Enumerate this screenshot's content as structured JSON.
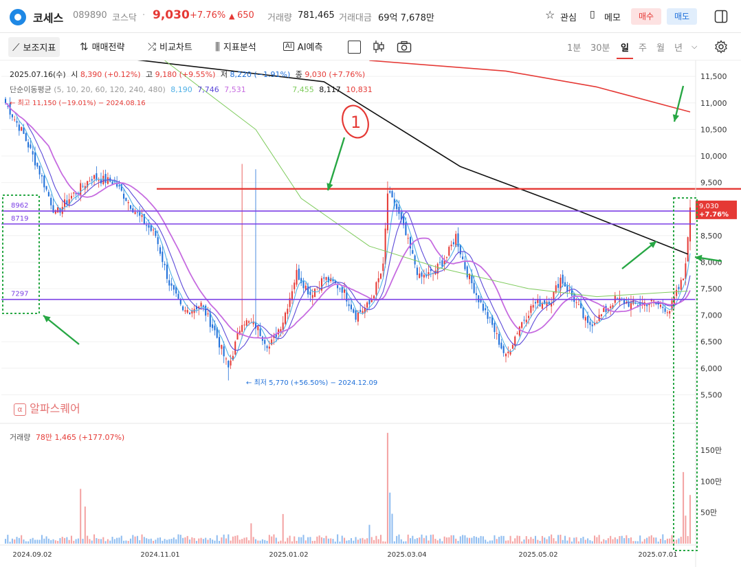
{
  "header": {
    "name": "코세스",
    "code": "089890",
    "market": "코스닥",
    "dot": "·",
    "price": "9,030",
    "change_pct": "+7.76%",
    "change_arrow": "▲",
    "change_amt": "650",
    "volume_label": "거래량",
    "volume": "781,465",
    "amount_label": "거래대금",
    "amount": "69억 7,678만",
    "fav_label": "관심",
    "memo_label": "메모",
    "buy_label": "매수",
    "sell_label": "매도"
  },
  "toolbar": {
    "indicators": "보조지표",
    "strategy": "매매전략",
    "compare": "비교차트",
    "analysis": "지표분석",
    "ai": "AI예측",
    "timeframes": [
      "1분",
      "30분",
      "일",
      "주",
      "월",
      "년"
    ],
    "active_timeframe": "일"
  },
  "ohlc": {
    "date": "2025.07.16(수)",
    "open_label": "시",
    "open": "8,390 (+0.12%)",
    "high_label": "고",
    "high": "9,180 (+9.55%)",
    "low_label": "저",
    "low": "8,220 (−1.91%)",
    "close_label": "종",
    "close": "9,030 (+7.76%)"
  },
  "ma": {
    "label": "단순이동평균",
    "periods": "(5, 10, 20, 60, 120, 240, 480)",
    "values": [
      {
        "v": "8,190",
        "color": "#4fb0e6"
      },
      {
        "v": "7,746",
        "color": "#5a48d8"
      },
      {
        "v": "7,531",
        "color": "#c66be0"
      },
      {
        "v": "7,455",
        "color": "#7ecb5c"
      },
      {
        "v": "8,117",
        "color": "#111111"
      },
      {
        "v": "10,831",
        "color": "#e53935"
      }
    ]
  },
  "annotations": {
    "high_marker": "최고 11,150 (−19.01%) − 2024.08.16",
    "low_marker": "최저 5,770 (+56.50%) − 2024.12.09",
    "handwritten": "1",
    "level_8962": "8962",
    "level_8719": "8719",
    "level_7297": "7297",
    "watermark": "알파스퀘어",
    "last_price": "9,030",
    "last_pct": "+7.76%"
  },
  "volume_panel": {
    "label": "거래량",
    "value": "78만 1,465 (+177.07%)",
    "ticks": [
      "150만",
      "100만",
      "50만"
    ]
  },
  "chart_data": {
    "type": "candlestick",
    "price_axis_ticks": [
      "11,500",
      "11,000",
      "10,500",
      "10,000",
      "9,500",
      "9,000",
      "8,500",
      "8,000",
      "7,500",
      "7,000",
      "6,500",
      "6,000",
      "5,500"
    ],
    "price_range": [
      5000,
      11800
    ],
    "date_ticks": [
      "2024.09.02",
      "2024.11.01",
      "2025.01.02",
      "2025.03.04",
      "2025.05.02",
      "2025.07.01"
    ],
    "horizontal_levels": [
      {
        "value": 9380,
        "color": "#e53935",
        "label": ""
      },
      {
        "value": 8962,
        "color": "#7b3fe4",
        "label": "8962"
      },
      {
        "value": 8719,
        "color": "#7b3fe4",
        "label": "8719"
      },
      {
        "value": 7297,
        "color": "#7b3fe4",
        "label": "7297"
      }
    ],
    "series_anchor_closes": [
      [
        0,
        11000
      ],
      [
        8,
        10400
      ],
      [
        15,
        9700
      ],
      [
        22,
        8900
      ],
      [
        28,
        9200
      ],
      [
        38,
        9600
      ],
      [
        48,
        9500
      ],
      [
        58,
        8900
      ],
      [
        66,
        8500
      ],
      [
        72,
        7600
      ],
      [
        78,
        7050
      ],
      [
        86,
        7200
      ],
      [
        92,
        6700
      ],
      [
        98,
        6000
      ],
      [
        104,
        6900
      ],
      [
        110,
        6800
      ],
      [
        116,
        6400
      ],
      [
        122,
        6900
      ],
      [
        128,
        7800
      ],
      [
        134,
        7400
      ],
      [
        140,
        7700
      ],
      [
        148,
        7500
      ],
      [
        154,
        7000
      ],
      [
        160,
        7200
      ],
      [
        166,
        7900
      ],
      [
        168,
        9300
      ],
      [
        172,
        9000
      ],
      [
        176,
        8500
      ],
      [
        182,
        7700
      ],
      [
        188,
        7800
      ],
      [
        194,
        8100
      ],
      [
        198,
        8500
      ],
      [
        202,
        7900
      ],
      [
        208,
        7300
      ],
      [
        214,
        6800
      ],
      [
        220,
        6200
      ],
      [
        226,
        6800
      ],
      [
        232,
        7200
      ],
      [
        240,
        7300
      ],
      [
        244,
        7700
      ],
      [
        250,
        7300
      ],
      [
        256,
        6800
      ],
      [
        262,
        7000
      ],
      [
        268,
        7300
      ],
      [
        276,
        7200
      ],
      [
        284,
        7250
      ],
      [
        292,
        7100
      ],
      [
        296,
        7500
      ],
      [
        298,
        7700
      ],
      [
        300,
        8400
      ],
      [
        301,
        9030
      ]
    ],
    "ma_overlays": [
      {
        "name": "MA240",
        "color": "#111111",
        "points": [
          [
            0,
            12100
          ],
          [
            140,
            11400
          ],
          [
            200,
            9800
          ],
          [
            250,
            9000
          ],
          [
            300,
            8150
          ]
        ]
      },
      {
        "name": "MA480",
        "color": "#e53935",
        "points": [
          [
            160,
            11800
          ],
          [
            220,
            11600
          ],
          [
            260,
            11300
          ],
          [
            301,
            10830
          ]
        ]
      },
      {
        "name": "MA60",
        "color": "#7ecb5c",
        "points": [
          [
            70,
            11800
          ],
          [
            110,
            10500
          ],
          [
            130,
            9200
          ],
          [
            160,
            8300
          ],
          [
            190,
            7900
          ],
          [
            230,
            7500
          ],
          [
            260,
            7350
          ],
          [
            300,
            7455
          ]
        ]
      }
    ],
    "volume_scale_max": 1800000
  }
}
